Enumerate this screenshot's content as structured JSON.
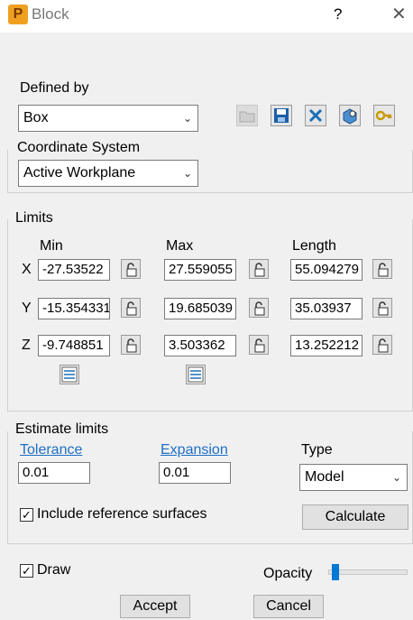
{
  "window": {
    "title": "Block",
    "help": "?",
    "close": "✕",
    "app_letter": "P"
  },
  "defined_by": {
    "label": "Defined by",
    "value": "Box"
  },
  "coordinate_system": {
    "label": "Coordinate System",
    "value": "Active Workplane"
  },
  "limits": {
    "label": "Limits",
    "headers": {
      "min": "Min",
      "max": "Max",
      "length": "Length"
    },
    "rows": [
      {
        "axis": "X",
        "min": "-27.53522",
        "max": "27.559055",
        "length": "55.094279"
      },
      {
        "axis": "Y",
        "min": "-15.354331",
        "max": "19.685039",
        "length": "35.03937"
      },
      {
        "axis": "Z",
        "min": "-9.748851",
        "max": "3.503362",
        "length": "13.252212"
      }
    ]
  },
  "estimate": {
    "label": "Estimate limits",
    "tolerance_label": "Tolerance",
    "tolerance_value": "0.01",
    "expansion_label": "Expansion",
    "expansion_value": "0.01",
    "type_label": "Type",
    "type_value": "Model",
    "include_label": "Include reference surfaces",
    "include_checked": "✓",
    "calculate_label": "Calculate"
  },
  "draw": {
    "label": "Draw",
    "checked": "✓"
  },
  "opacity": {
    "label": "Opacity",
    "level": 0.05
  },
  "buttons": {
    "accept": "Accept",
    "cancel": "Cancel"
  }
}
